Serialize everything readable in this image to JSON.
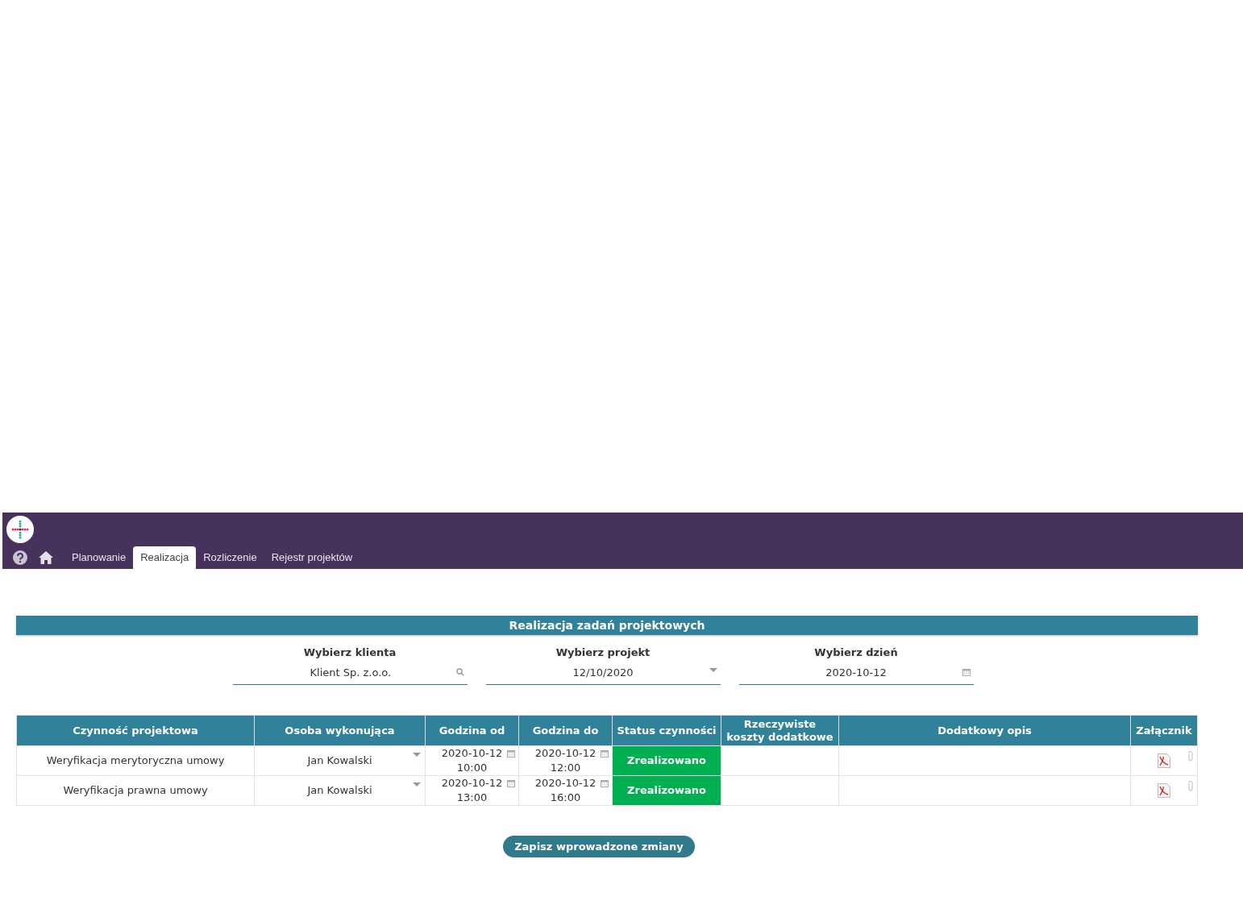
{
  "nav": {
    "tabs": [
      {
        "label": "Planowanie",
        "selected": false
      },
      {
        "label": "Realizacja",
        "selected": true
      },
      {
        "label": "Rozliczenie",
        "selected": false
      },
      {
        "label": "Rejestr projektów",
        "selected": false
      }
    ]
  },
  "panel": {
    "title": "Realizacja zadań projektowych",
    "filters": [
      {
        "label": "Wybierz klienta",
        "value": "Klient Sp. z.o.o.",
        "kind": "search"
      },
      {
        "label": "Wybierz projekt",
        "value": "12/10/2020",
        "kind": "select"
      },
      {
        "label": "Wybierz dzień",
        "value": "2020-10-12",
        "kind": "date"
      }
    ]
  },
  "table": {
    "columns": [
      "Czynność projektowa",
      "Osoba wykonująca",
      "Godzina od",
      "Godzina do",
      "Status czynności",
      "Rzeczywiste koszty dodatkowe",
      "Dodatkowy opis",
      "Załącznik"
    ],
    "rows": [
      {
        "activity": "Weryfikacja merytoryczna umowy",
        "person": "Jan Kowalski",
        "from_date": "2020-10-12",
        "from_time": "10:00",
        "to_date": "2020-10-12",
        "to_time": "12:00",
        "status": "Zrealizowano"
      },
      {
        "activity": "Weryfikacja prawna umowy",
        "person": "Jan Kowalski",
        "from_date": "2020-10-12",
        "from_time": "13:00",
        "to_date": "2020-10-12",
        "to_time": "16:00",
        "status": "Zrealizowano"
      }
    ]
  },
  "save_button": "Zapisz wprowadzone zmiany"
}
